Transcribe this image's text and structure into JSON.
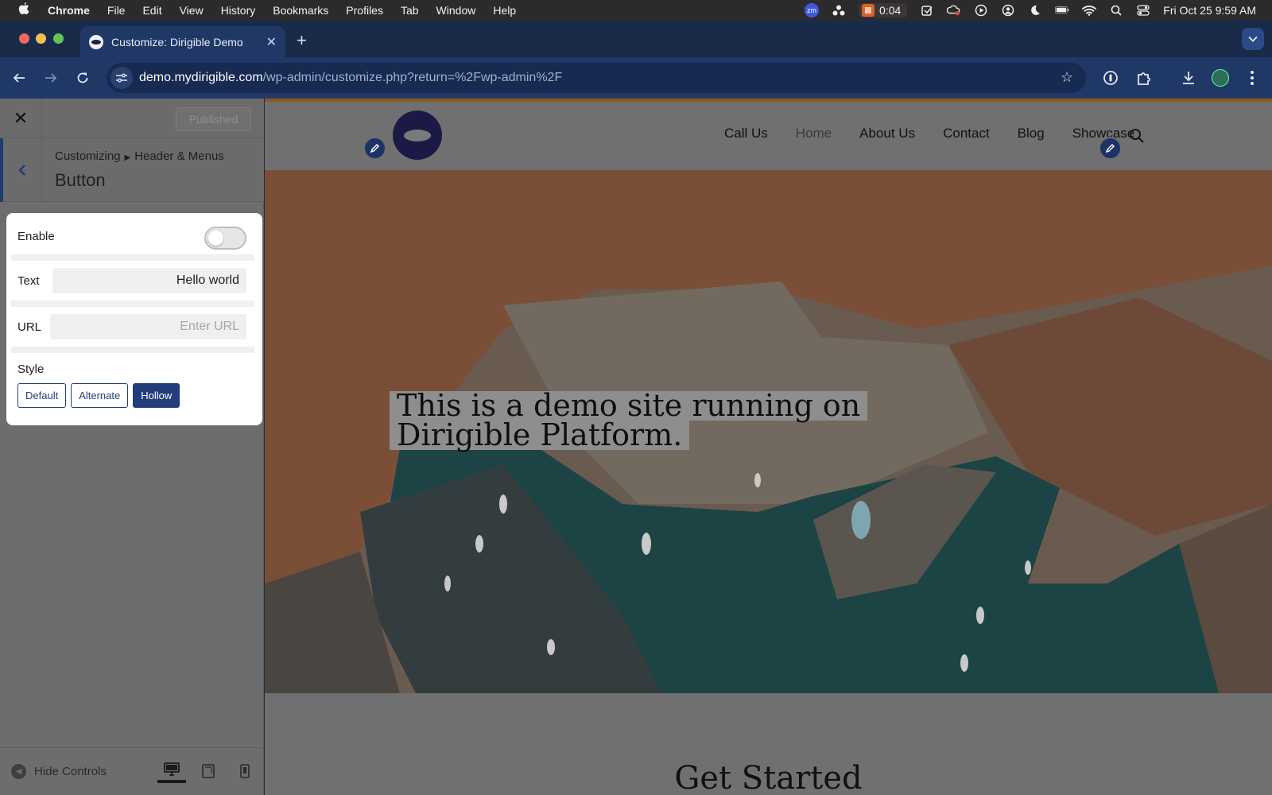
{
  "menubar": {
    "app": "Chrome",
    "items": [
      "File",
      "Edit",
      "View",
      "History",
      "Bookmarks",
      "Profiles",
      "Tab",
      "Window",
      "Help"
    ],
    "zoom_badge": "zm",
    "record_time": "0:04",
    "clock": "Fri Oct 25  9:59 AM"
  },
  "browser": {
    "tab_title": "Customize: Dirigible Demo",
    "url_host": "demo.mydirigible.com",
    "url_path": "/wp-admin/customize.php?return=%2Fwp-admin%2F"
  },
  "customizer": {
    "published_label": "Published",
    "breadcrumb_root": "Customizing",
    "breadcrumb_section": "Header & Menus",
    "section_title": "Button",
    "enable_label": "Enable",
    "enable_value": false,
    "text_label": "Text",
    "text_value": "Hello world",
    "url_label": "URL",
    "url_placeholder": "Enter URL",
    "style_label": "Style",
    "style_options": [
      "Default",
      "Alternate",
      "Hollow"
    ],
    "style_selected": "Hollow",
    "hide_controls_label": "Hide Controls",
    "device_selected": "desktop"
  },
  "site": {
    "nav": [
      "Call Us",
      "Home",
      "About Us",
      "Contact",
      "Blog",
      "Showcase"
    ],
    "hero_line1": "This is a demo site running on",
    "hero_line2": "Dirigible Platform.",
    "section_heading": "Get Started"
  },
  "colors": {
    "chrome_frame": "#1a2b4a",
    "chrome_toolbar": "#203866",
    "brand_accent": "#233d7b",
    "overlay_dim": "#6f6f6f"
  }
}
